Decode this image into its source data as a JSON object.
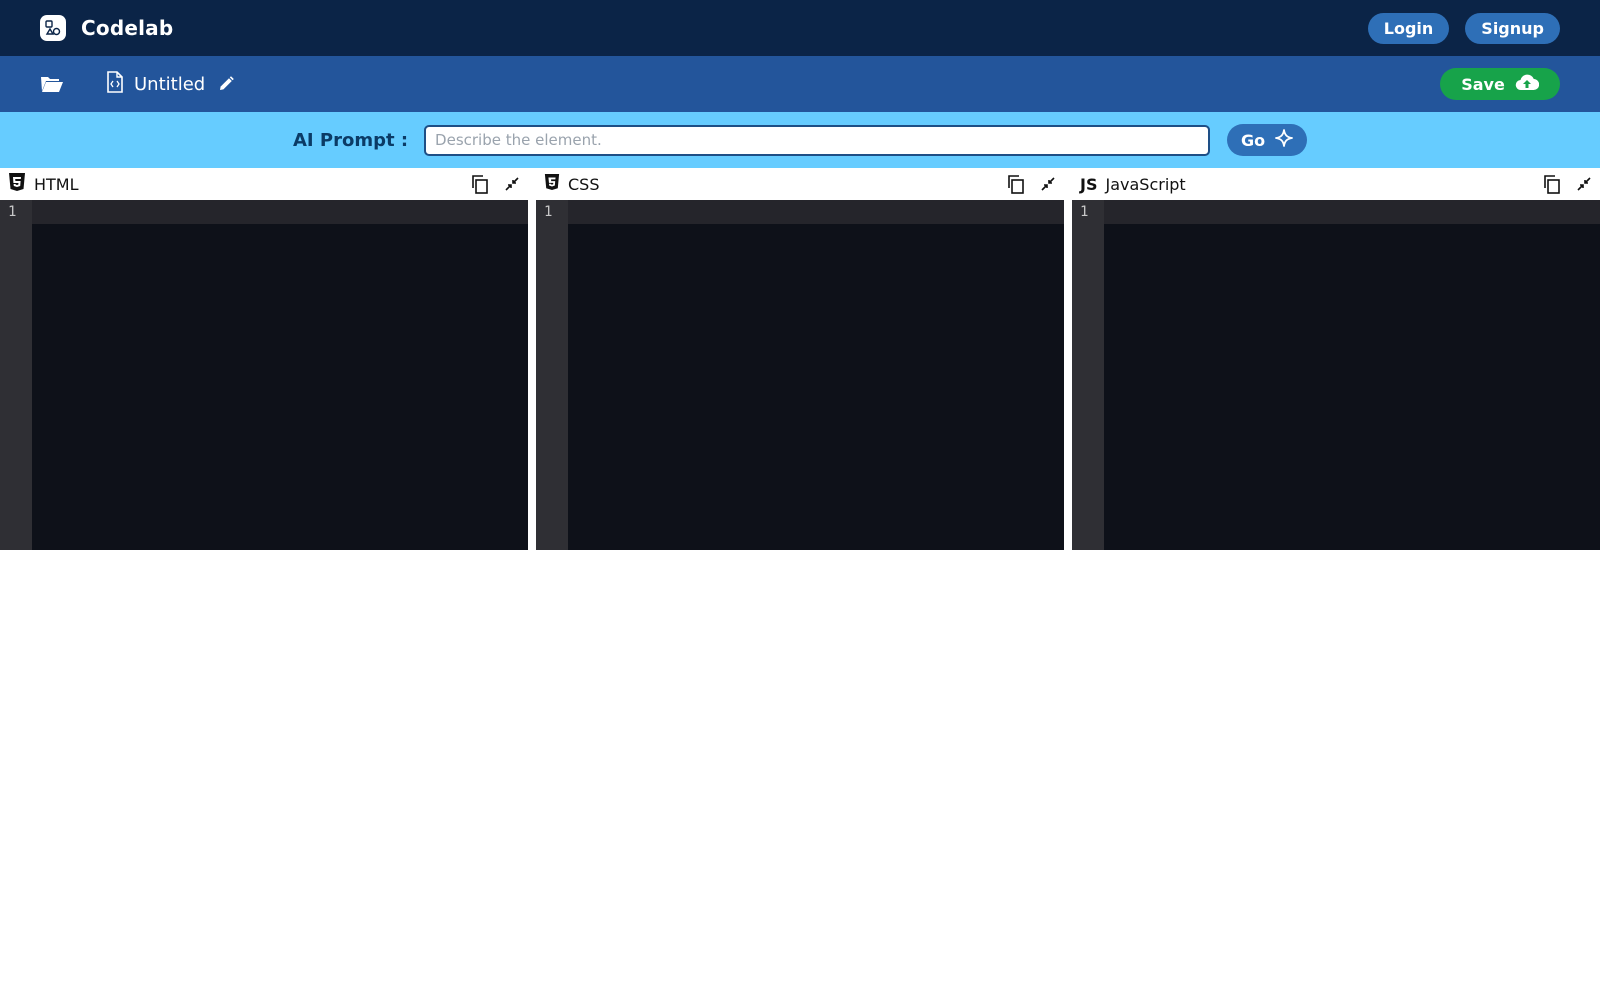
{
  "app": {
    "brand_name": "Codelab",
    "login_label": "Login",
    "signup_label": "Signup"
  },
  "file": {
    "title": "Untitled",
    "save_label": "Save"
  },
  "ai": {
    "label": "AI Prompt :",
    "placeholder": "Describe the element.",
    "go_label": "Go"
  },
  "editors": [
    {
      "name": "HTML",
      "icon": "html5-icon",
      "line_numbers": [
        "1"
      ]
    },
    {
      "name": "CSS",
      "icon": "css3-icon",
      "line_numbers": [
        "1"
      ]
    },
    {
      "name": "JavaScript",
      "icon": "js-icon",
      "badge": "JS",
      "line_numbers": [
        "1"
      ]
    }
  ],
  "colors": {
    "topbar": "#0b2447",
    "filebar": "#23559b",
    "aibar": "#66ccff",
    "save": "#17a34a",
    "pill": "#2e6fb7",
    "editor_bg": "#0e1119",
    "gutter_bg": "#2f2f34"
  }
}
